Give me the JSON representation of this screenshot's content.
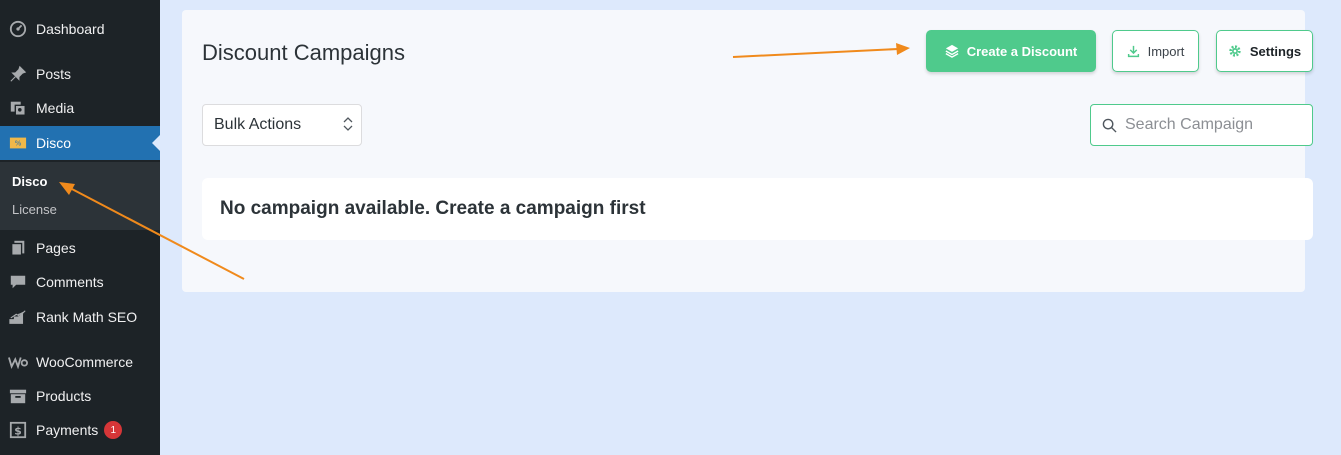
{
  "sidebar": {
    "items": [
      {
        "label": "Dashboard",
        "icon": "dashboard-icon"
      },
      {
        "label": "Posts",
        "icon": "pin-icon"
      },
      {
        "label": "Media",
        "icon": "media-icon"
      },
      {
        "label": "Disco",
        "icon": "ticket-icon"
      },
      {
        "label": "Pages",
        "icon": "pages-icon"
      },
      {
        "label": "Comments",
        "icon": "comment-icon"
      },
      {
        "label": "Rank Math SEO",
        "icon": "chart-icon"
      },
      {
        "label": "WooCommerce",
        "icon": "woo-icon"
      },
      {
        "label": "Products",
        "icon": "archive-icon"
      },
      {
        "label": "Payments",
        "icon": "dollar-icon",
        "badge": "1"
      }
    ],
    "submenu": [
      {
        "label": "Disco"
      },
      {
        "label": "License"
      }
    ]
  },
  "main": {
    "title": "Discount Campaigns",
    "buttons": {
      "create": "Create a Discount",
      "import": "Import",
      "settings": "Settings"
    },
    "bulk_actions": "Bulk Actions",
    "search_placeholder": "Search Campaign",
    "empty_message": "No campaign available. Create a campaign first"
  },
  "colors": {
    "sidebar_bg": "#1d2327",
    "active_blue": "#2271b1",
    "accent_green": "#4fca8c",
    "annotation_orange": "#f08a1c",
    "page_bg": "#dde9fc"
  }
}
